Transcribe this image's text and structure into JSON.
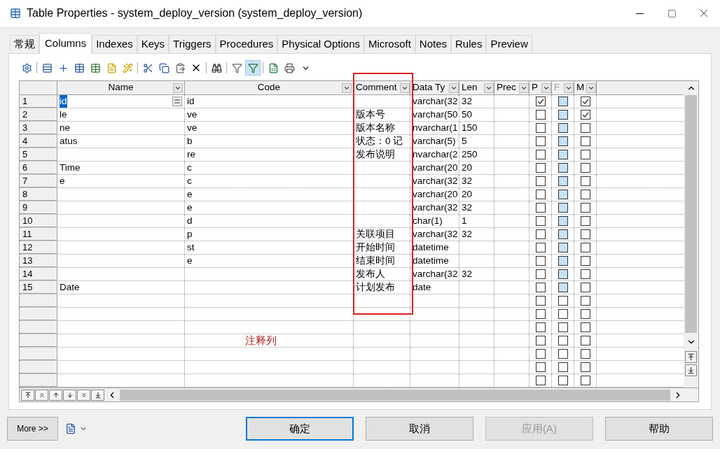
{
  "window": {
    "title": "Table Properties - system_deploy_version (system_deploy_version)"
  },
  "tabs": [
    {
      "label": "常规",
      "selected": false
    },
    {
      "label": "Columns",
      "selected": true
    },
    {
      "label": "Indexes",
      "selected": false
    },
    {
      "label": "Keys",
      "selected": false
    },
    {
      "label": "Triggers",
      "selected": false
    },
    {
      "label": "Procedures",
      "selected": false
    },
    {
      "label": "Physical Options",
      "selected": false
    },
    {
      "label": "Microsoft",
      "selected": false
    },
    {
      "label": "Notes",
      "selected": false
    },
    {
      "label": "Rules",
      "selected": false
    },
    {
      "label": "Preview",
      "selected": false
    }
  ],
  "columns": [
    {
      "label": "Name",
      "disabled": false
    },
    {
      "label": "Code",
      "disabled": false
    },
    {
      "label": "Comment",
      "disabled": false
    },
    {
      "label": "Data Ty",
      "disabled": false
    },
    {
      "label": "Len",
      "disabled": false
    },
    {
      "label": "Prec",
      "disabled": false
    },
    {
      "label": "P",
      "disabled": false
    },
    {
      "label": "F",
      "disabled": true
    },
    {
      "label": "M",
      "disabled": false
    }
  ],
  "rows": [
    {
      "number": "1",
      "name": "id",
      "code": "id",
      "comment": "",
      "data_type": "varchar(32",
      "length": "32",
      "selected": true,
      "primary": true,
      "foreign": false,
      "foreign_disabled": true,
      "mandatory": true
    },
    {
      "number": "2",
      "name": "le",
      "code": "ve",
      "comment": "版本号",
      "data_type": "varchar(50",
      "length": "50",
      "selected": false,
      "primary": false,
      "foreign": false,
      "foreign_disabled": true,
      "mandatory": true
    },
    {
      "number": "3",
      "name": "ne",
      "code": "ve",
      "comment": "版本名称",
      "data_type": "nvarchar(1",
      "length": "150",
      "selected": false,
      "primary": false,
      "foreign": false,
      "foreign_disabled": true,
      "mandatory": false
    },
    {
      "number": "4",
      "name": "atus",
      "code": "b",
      "comment": "状态：0 记",
      "data_type": "varchar(5)",
      "length": "5",
      "selected": false,
      "primary": false,
      "foreign": false,
      "foreign_disabled": true,
      "mandatory": false
    },
    {
      "number": "5",
      "name": "",
      "code": "re",
      "comment": "发布说明",
      "data_type": "nvarchar(2",
      "length": "250",
      "selected": false,
      "primary": false,
      "foreign": false,
      "foreign_disabled": true,
      "mandatory": false
    },
    {
      "number": "6",
      "name": "Time",
      "code": "c",
      "comment": "",
      "data_type": "varchar(20",
      "length": "20",
      "selected": false,
      "primary": false,
      "foreign": false,
      "foreign_disabled": true,
      "mandatory": false
    },
    {
      "number": "7",
      "name": "e",
      "code": "c",
      "comment": "",
      "data_type": "varchar(32",
      "length": "32",
      "selected": false,
      "primary": false,
      "foreign": false,
      "foreign_disabled": true,
      "mandatory": false
    },
    {
      "number": "8",
      "name": "",
      "code": "e",
      "comment": "",
      "data_type": "varchar(20",
      "length": "20",
      "selected": false,
      "primary": false,
      "foreign": false,
      "foreign_disabled": true,
      "mandatory": false
    },
    {
      "number": "9",
      "name": "",
      "code": "e",
      "comment": "",
      "data_type": "varchar(32",
      "length": "32",
      "selected": false,
      "primary": false,
      "foreign": false,
      "foreign_disabled": true,
      "mandatory": false
    },
    {
      "number": "10",
      "name": "",
      "code": "d",
      "comment": "",
      "data_type": "char(1)",
      "length": "1",
      "selected": false,
      "primary": false,
      "foreign": false,
      "foreign_disabled": true,
      "mandatory": false
    },
    {
      "number": "11",
      "name": "",
      "code": "p",
      "comment": "关联项目",
      "data_type": "varchar(32",
      "length": "32",
      "selected": false,
      "primary": false,
      "foreign": false,
      "foreign_disabled": true,
      "mandatory": false
    },
    {
      "number": "12",
      "name": "",
      "code": "st",
      "comment": "开始时间",
      "data_type": "datetime",
      "length": "",
      "selected": false,
      "primary": false,
      "foreign": false,
      "foreign_disabled": true,
      "mandatory": false
    },
    {
      "number": "13",
      "name": "",
      "code": "e",
      "comment": "结束时间",
      "data_type": "datetime",
      "length": "",
      "selected": false,
      "primary": false,
      "foreign": false,
      "foreign_disabled": true,
      "mandatory": false
    },
    {
      "number": "14",
      "name": "",
      "code": "",
      "comment": "发布人",
      "data_type": "varchar(32",
      "length": "32",
      "selected": false,
      "primary": false,
      "foreign": false,
      "foreign_disabled": true,
      "mandatory": false
    },
    {
      "number": "15",
      "name": "Date",
      "code": "",
      "comment": "计划发布",
      "data_type": "date",
      "length": "",
      "selected": false,
      "primary": false,
      "foreign": false,
      "foreign_disabled": true,
      "mandatory": false
    },
    {
      "number": "",
      "name": "",
      "code": "",
      "comment": "",
      "data_type": "",
      "length": "",
      "selected": false,
      "primary": false,
      "foreign": false,
      "foreign_disabled": false,
      "mandatory": false
    },
    {
      "number": "",
      "name": "",
      "code": "",
      "comment": "",
      "data_type": "",
      "length": "",
      "selected": false,
      "primary": false,
      "foreign": false,
      "foreign_disabled": false,
      "mandatory": false
    },
    {
      "number": "",
      "name": "",
      "code": "",
      "comment": "",
      "data_type": "",
      "length": "",
      "selected": false,
      "primary": false,
      "foreign": false,
      "foreign_disabled": false,
      "mandatory": false
    },
    {
      "number": "",
      "name": "",
      "code": "",
      "comment": "",
      "data_type": "",
      "length": "",
      "selected": false,
      "primary": false,
      "foreign": false,
      "foreign_disabled": false,
      "mandatory": false
    },
    {
      "number": "",
      "name": "",
      "code": "",
      "comment": "",
      "data_type": "",
      "length": "",
      "selected": false,
      "primary": false,
      "foreign": false,
      "foreign_disabled": false,
      "mandatory": false
    },
    {
      "number": "",
      "name": "",
      "code": "",
      "comment": "",
      "data_type": "",
      "length": "",
      "selected": false,
      "primary": false,
      "foreign": false,
      "foreign_disabled": false,
      "mandatory": false
    },
    {
      "number": "",
      "name": "",
      "code": "",
      "comment": "",
      "data_type": "",
      "length": "",
      "selected": false,
      "primary": false,
      "foreign": false,
      "foreign_disabled": false,
      "mandatory": false
    }
  ],
  "annotation": {
    "label": "注释列"
  },
  "more_button": "More >>",
  "buttons": [
    {
      "label": "确定",
      "kind": "default",
      "disabled": false
    },
    {
      "label": "取消",
      "kind": "normal",
      "disabled": false
    },
    {
      "label": "应用(A)",
      "kind": "normal",
      "disabled": true
    },
    {
      "label": "帮助",
      "kind": "normal",
      "disabled": false
    }
  ]
}
